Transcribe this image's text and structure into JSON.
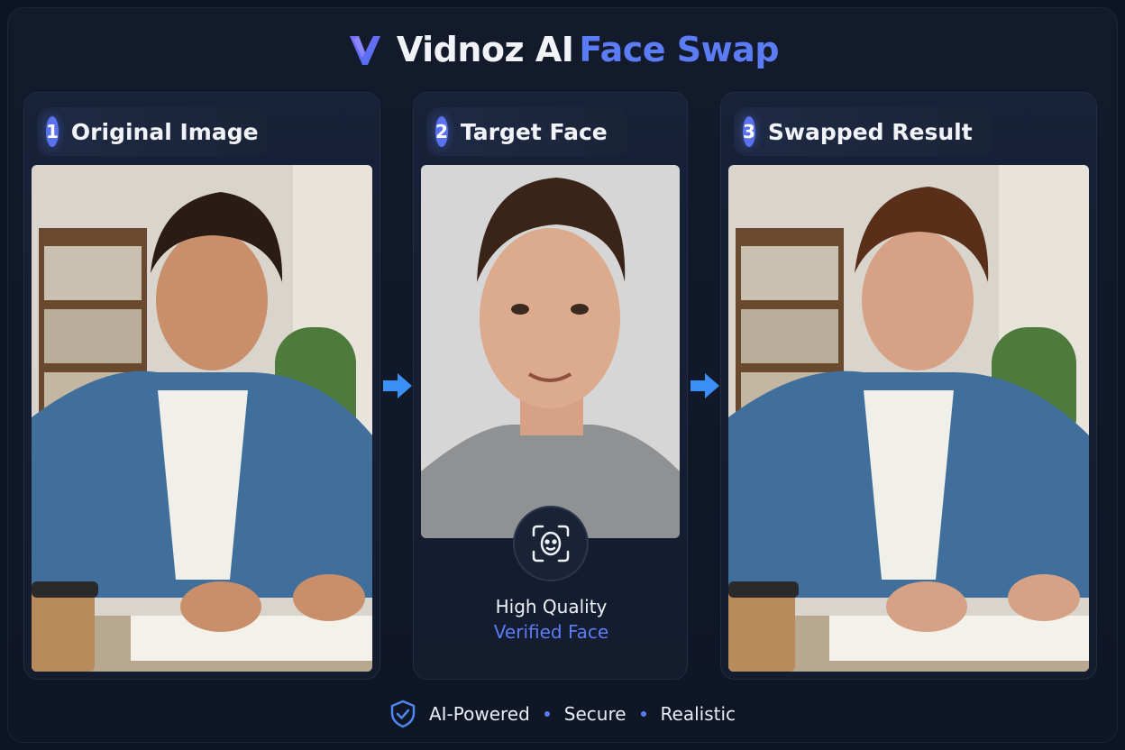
{
  "header": {
    "brand_primary": "Vidnoz AI",
    "brand_secondary": "Face Swap",
    "logo_icon": "vidnoz-v-logo-icon"
  },
  "steps": [
    {
      "number": "1",
      "label": "Original Image"
    },
    {
      "number": "2",
      "label": "Target Face"
    },
    {
      "number": "3",
      "label": "Swapped Result"
    }
  ],
  "target": {
    "badge_icon": "face-scan-icon",
    "quality_label": "High Quality",
    "verified_label": "Verified Face"
  },
  "footer": {
    "icon": "shield-check-icon",
    "items": [
      "AI-Powered",
      "Secure",
      "Realistic"
    ]
  },
  "colors": {
    "accent": "#5c7cf5",
    "step_badge": "#5a72f0",
    "arrow": "#3b8ff5",
    "background": "#0d1424"
  }
}
